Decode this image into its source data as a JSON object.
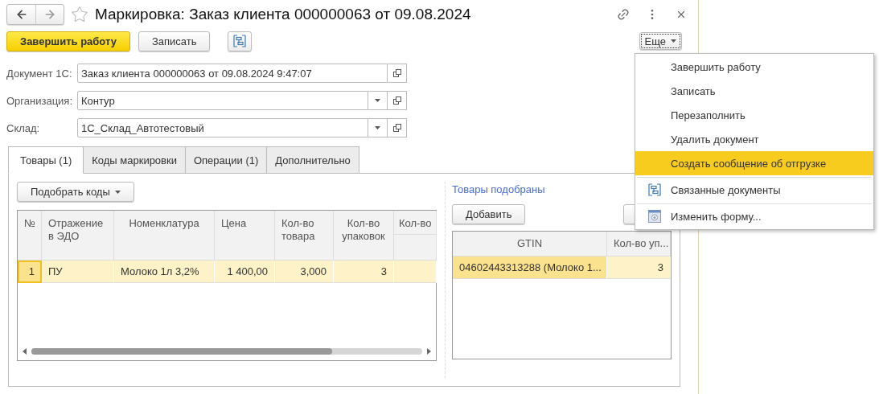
{
  "window": {
    "title": "Маркировка: Заказ клиента 000000063 от 09.08.2024"
  },
  "toolbar": {
    "primary": "Завершить работу",
    "secondary": "Записать",
    "more": "Еще"
  },
  "fields": [
    {
      "label": "Документ 1С:",
      "value": "Заказ клиента 000000063 от 09.08.2024 9:47:07",
      "dropdown": false
    },
    {
      "label": "Организация:",
      "value": "Контур",
      "dropdown": true
    },
    {
      "label": "Склад:",
      "value": "1С_Склад_Автотестовый",
      "dropdown": true
    }
  ],
  "tabs": [
    {
      "label": "Товары (1)",
      "selected": true
    },
    {
      "label": "Коды маркировки",
      "selected": false
    },
    {
      "label": "Операции (1)",
      "selected": false
    },
    {
      "label": "Дополнительно",
      "selected": false
    }
  ],
  "left": {
    "button": "Подобрать коды",
    "columns": [
      "№",
      "Отражение в ЭДО",
      "Номенклатура",
      "Цена",
      "Кол-во товара",
      "Кол-во упаковок",
      "Кол-во"
    ],
    "rows": [
      {
        "selected": true,
        "cells": [
          "1",
          "ПУ",
          "Молоко 1л 3,2%",
          "1 400,00",
          "3,000",
          "3"
        ]
      }
    ]
  },
  "right": {
    "title": "Товары подобраны",
    "button": "Добавить",
    "columns": [
      "GTIN",
      "Кол-во уп..."
    ],
    "rows": [
      {
        "selected": true,
        "cells": [
          "04602443313288 (Молоко 1...",
          "3"
        ]
      }
    ]
  },
  "menu": {
    "items": [
      {
        "label": "Завершить работу",
        "kind": "plain",
        "selected": false,
        "separator": false
      },
      {
        "label": "Записать",
        "kind": "plain",
        "selected": false,
        "separator": false
      },
      {
        "label": "Перезаполнить",
        "kind": "plain",
        "selected": false,
        "separator": false
      },
      {
        "label": "Удалить документ",
        "kind": "plain",
        "selected": false,
        "separator": false
      },
      {
        "label": "Создать сообщение об отгрузке",
        "kind": "plain",
        "selected": true,
        "separator": false
      },
      {
        "label": "Связанные документы",
        "kind": "structure",
        "selected": false,
        "separator": true
      },
      {
        "label": "Изменить форму...",
        "kind": "form",
        "selected": false,
        "separator": true
      }
    ]
  }
}
